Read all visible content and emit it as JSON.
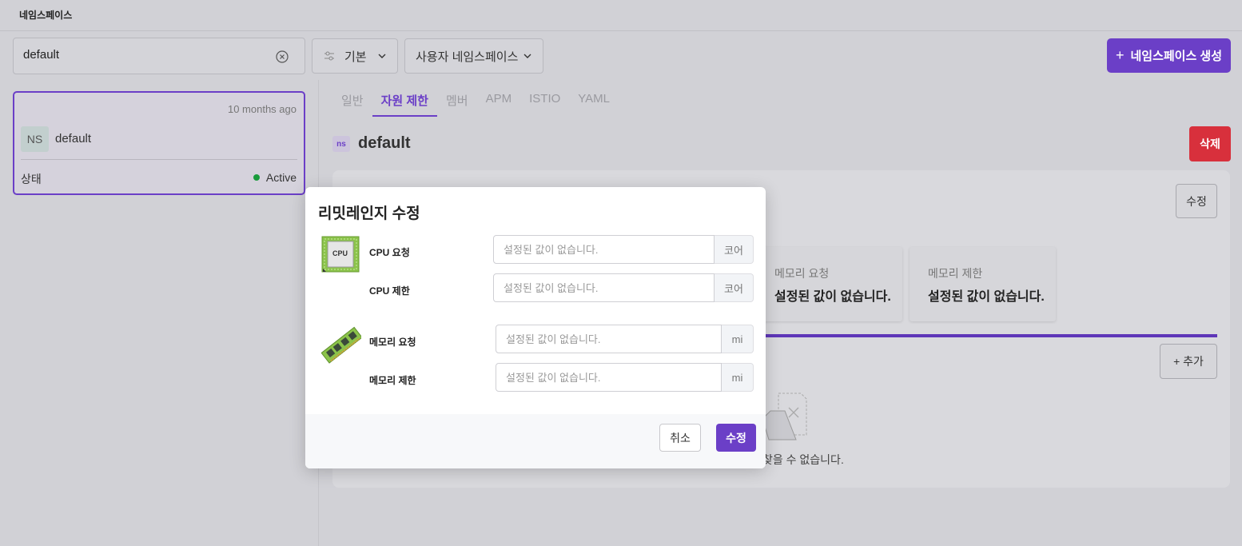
{
  "app": {
    "title": "네임스페이스"
  },
  "search": {
    "value": "default"
  },
  "filters": {
    "preset_label": "기본",
    "type_label": "사용자 네임스페이스"
  },
  "create_button": {
    "plus": "+",
    "label": "네임스페이스 생성"
  },
  "namespace_card": {
    "time": "10 months ago",
    "avatar": "NS",
    "name": "default",
    "status_label": "상태",
    "status_value": "Active"
  },
  "tabs": [
    "일반",
    "자원 제한",
    "멤버",
    "APM",
    "ISTIO",
    "YAML"
  ],
  "active_tab": "자원 제한",
  "detail": {
    "badge": "ns",
    "title": "default",
    "delete_label": "삭제",
    "edit_label": "수정",
    "add_label": "+ 추가",
    "cards": [
      {
        "label": "메모리 요청",
        "value": "설정된 값이 없습니다."
      },
      {
        "label": "메모리 제한",
        "value": "설정된 값이 없습니다."
      }
    ],
    "empty_text": "찾을 수 없습니다."
  },
  "modal": {
    "title": "리밋레인지 수정",
    "cpu_icon_text": "CPU",
    "fields": [
      {
        "label": "CPU 요청",
        "placeholder": "설정된 값이 없습니다.",
        "unit": "코어"
      },
      {
        "label": "CPU 제한",
        "placeholder": "설정된 값이 없습니다.",
        "unit": "코어"
      },
      {
        "label": "메모리 요청",
        "placeholder": "설정된 값이 없습니다.",
        "unit": "mi"
      },
      {
        "label": "메모리 제한",
        "placeholder": "설정된 값이 없습니다.",
        "unit": "mi"
      }
    ],
    "cancel_label": "취소",
    "submit_label": "수정"
  },
  "colors": {
    "accent": "#6b3fc7",
    "danger": "#d8303c",
    "status_active": "#1a9b3c"
  }
}
